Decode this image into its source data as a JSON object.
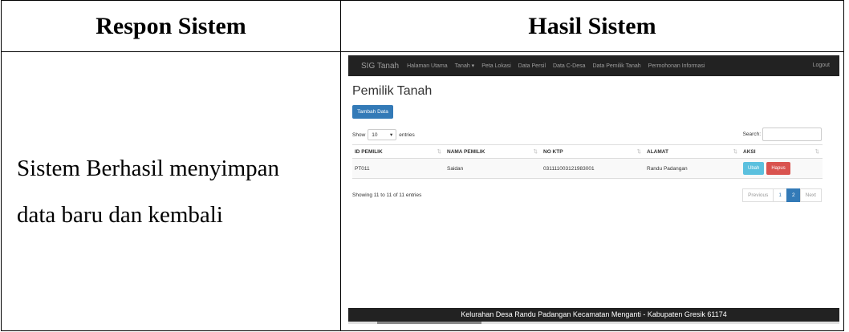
{
  "document": {
    "header_left": "Respon Sistem",
    "header_right": "Hasil Sistem",
    "response_line1": "Sistem Berhasil menyimpan",
    "response_line2": "data baru dan kembali"
  },
  "screenshot": {
    "navbar": {
      "brand": "SIG Tanah",
      "items": [
        "Halaman Utama",
        "Tanah ▾",
        "Peta Lokasi",
        "Data Persil",
        "Data C-Desa",
        "Data Pemilik Tanah",
        "Permohonan Informasi"
      ],
      "logout": "Logout"
    },
    "page_title": "Pemilik Tanah",
    "add_button": "Tambah Data",
    "show_label": "Show",
    "entries_value": "10",
    "entries_label": "entries",
    "search_label": "Search:",
    "columns": [
      "ID PEMILIK",
      "NAMA PEMILIK",
      "NO KTP",
      "ALAMAT",
      "AKSI"
    ],
    "rows": [
      {
        "id": "PT011",
        "name": "Saidan",
        "ktp": "031111003121983001",
        "address": "Randu Padangan",
        "edit": "Ubah",
        "delete": "Hapus"
      }
    ],
    "info": "Showing 11 to 11 of 11 entries",
    "pagination": [
      "Previous",
      "1",
      "2",
      "Next"
    ],
    "footer": "Kelurahan Desa Randu Padangan Kecamatan Menganti - Kabupaten Gresik 61174",
    "colors": {
      "navbar": "#222222",
      "primary": "#337ab7",
      "info": "#5bc0de",
      "danger": "#d9534f"
    }
  }
}
